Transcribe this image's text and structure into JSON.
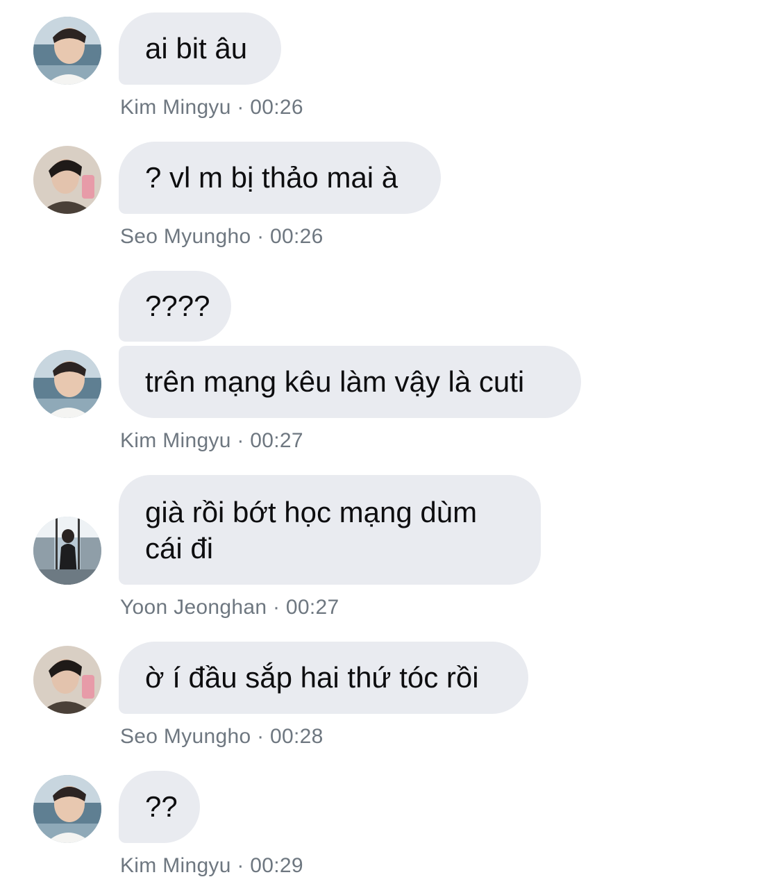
{
  "messages": [
    {
      "text": "ai bit âu",
      "sender": "Kim Mingyu",
      "time": "00:26",
      "sep": "·"
    },
    {
      "text": "? vl m bị thảo mai à",
      "sender": "Seo Myungho",
      "time": "00:26",
      "sep": "·"
    },
    {
      "text": "????"
    },
    {
      "text": "trên mạng kêu làm vậy là cuti",
      "sender": "Kim Mingyu",
      "time": "00:27",
      "sep": "·"
    },
    {
      "text": "già rồi bớt học mạng dùm cái đi",
      "sender": "Yoon Jeonghan",
      "time": "00:27",
      "sep": "·"
    },
    {
      "text": "ờ í đầu sắp hai thứ tóc rồi",
      "sender": "Seo Myungho",
      "time": "00:28",
      "sep": "·"
    },
    {
      "text": "??",
      "sender": "Kim Mingyu",
      "time": "00:29",
      "sep": "·"
    }
  ],
  "colors": {
    "bubble_bg": "#e9ebf0",
    "meta_text": "#6e7780",
    "message_text": "#0d0d0f"
  }
}
